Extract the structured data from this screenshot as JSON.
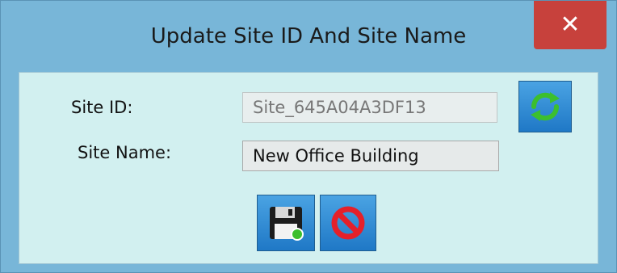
{
  "window": {
    "title": "Update Site ID And Site Name",
    "close_glyph": "✕"
  },
  "form": {
    "site_id_label": "Site ID:",
    "site_id_value": "Site_645A04A3DF13",
    "site_name_label": "Site Name:",
    "site_name_value": "New Office Building"
  },
  "buttons": {
    "refresh_icon": "refresh-icon",
    "save_icon": "floppy-disk-icon",
    "cancel_icon": "prohibited-icon"
  },
  "colors": {
    "window_frame": "#78b6d8",
    "client_background": "#d2f0f0",
    "close_button": "#c7413c",
    "button_blue": "#1f78c6",
    "refresh_green": "#3cbf2e",
    "cancel_red": "#e5202a"
  }
}
